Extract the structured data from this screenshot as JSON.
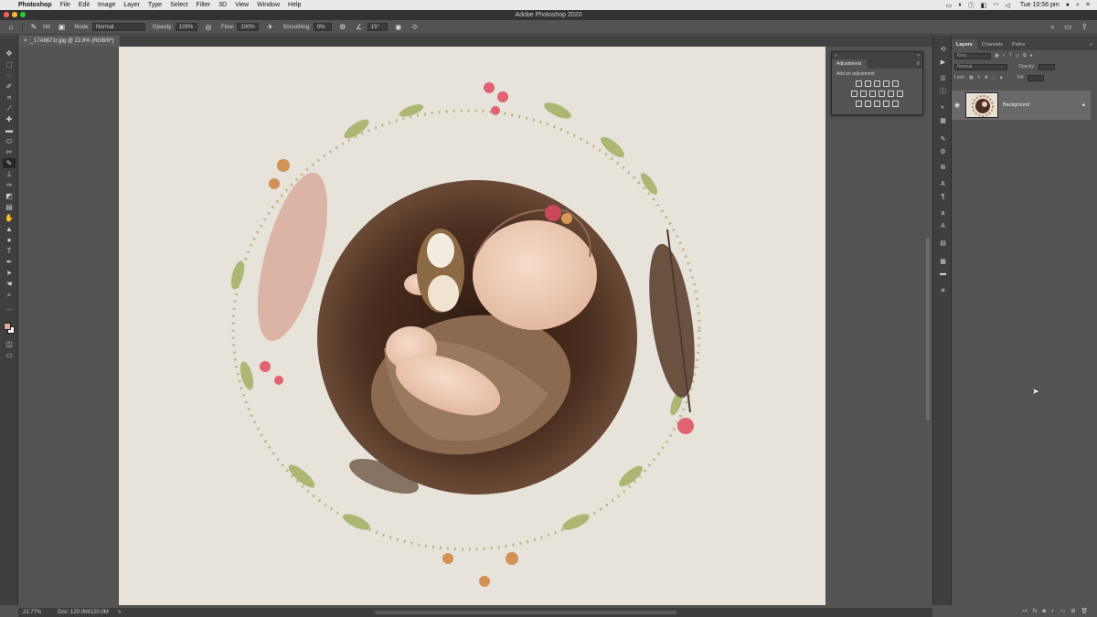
{
  "menubar": {
    "app_name": "Photoshop",
    "menus": [
      "File",
      "Edit",
      "Image",
      "Layer",
      "Type",
      "Select",
      "Filter",
      "3D",
      "View",
      "Window",
      "Help"
    ],
    "clock": "Tue 10:56 pm"
  },
  "titlebar": {
    "title": "Adobe Photoshop 2020"
  },
  "options": {
    "brush_size": "500",
    "mode_label": "Mode:",
    "mode_value": "Normal",
    "opacity_label": "Opacity:",
    "opacity_value": "100%",
    "flow_label": "Flow:",
    "flow_value": "100%",
    "smoothing_label": "Smoothing:",
    "smoothing_value": "0%",
    "angle_value": "15°"
  },
  "document": {
    "tab_label": "_17A9671r.jpg @ 22.8% (RGB/8*)"
  },
  "statusbar": {
    "zoom": "22.77%",
    "doc_info": "Doc: 120.0M/120.0M",
    "arrow": ">"
  },
  "adjustments": {
    "tab_label": "Adjustments",
    "add_label": "Add an adjustment"
  },
  "layers": {
    "tabs": [
      "Layers",
      "Channels",
      "Paths"
    ],
    "kind_placeholder": "Kind",
    "blend_mode": "Normal",
    "opacity_label": "Opacity:",
    "lock_label": "Lock:",
    "fill_label": "Fill:",
    "layer_name": "Background"
  },
  "colors": {
    "foreground": "#e8a8a0",
    "background": "#ffffff",
    "canvas": "#e7e2da",
    "nest": "#4a2e1f"
  }
}
